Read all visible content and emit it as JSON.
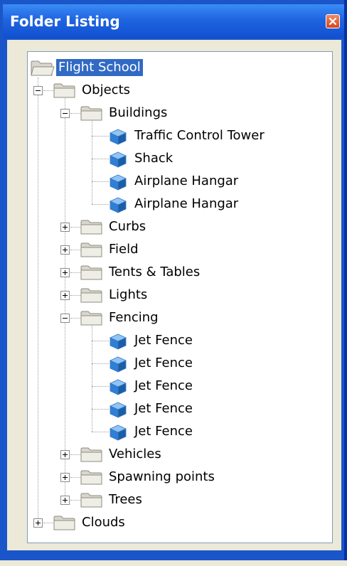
{
  "window": {
    "title": "Folder Listing"
  },
  "tree": {
    "root": "Flight School",
    "objects": "Objects",
    "buildings": "Buildings",
    "building_items": [
      "Traffic Control Tower",
      "Shack",
      "Airplane Hangar",
      "Airplane Hangar"
    ],
    "curbs": "Curbs",
    "field": "Field",
    "tents": "Tents & Tables",
    "lights": "Lights",
    "fencing": "Fencing",
    "fencing_items": [
      "Jet Fence",
      "Jet Fence",
      "Jet Fence",
      "Jet Fence",
      "Jet Fence"
    ],
    "vehicles": "Vehicles",
    "spawning": "Spawning points",
    "trees": "Trees",
    "clouds": "Clouds"
  },
  "icons": {
    "folder": "folder-icon",
    "folder_open": "folder-open-icon",
    "object": "cube-icon",
    "expand": "plus-expander-icon",
    "collapse": "minus-expander-icon",
    "close": "close-icon"
  },
  "colors": {
    "titlebar": "#1f64e0",
    "selection": "#316ac5",
    "folder": "#d8d6cc",
    "cube": "#2f7fd6"
  }
}
